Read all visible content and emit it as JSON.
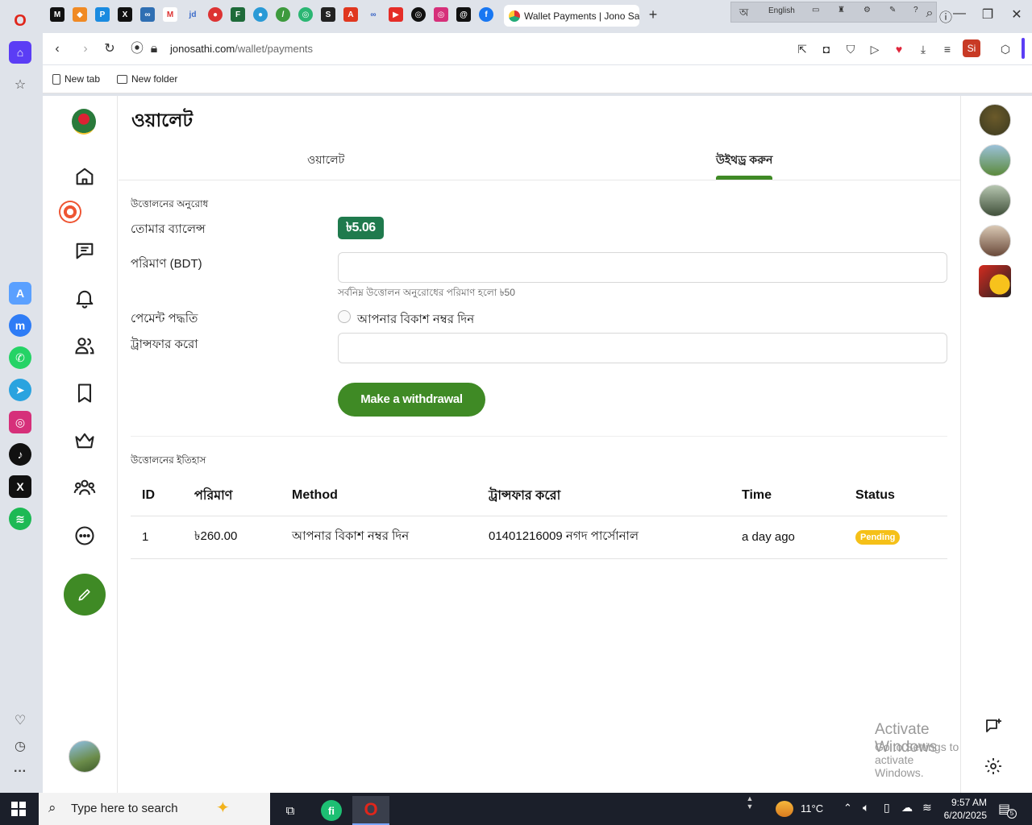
{
  "browser": {
    "active_tab_title": "Wallet Payments | Jono Sa",
    "new_tab_symbol": "+",
    "url_host": "jonosathi.com",
    "url_path": "/wallet/payments",
    "profile_initials": "Si",
    "tray_language": "English",
    "bookmarks": [
      "New tab",
      "New folder"
    ]
  },
  "page": {
    "title": "ওয়ালেট",
    "tabs": [
      {
        "label": "ওয়ালেট",
        "active": false
      },
      {
        "label": "উইথড্র করুন",
        "active": true
      }
    ],
    "withdraw_form": {
      "section_title": "উত্তোলনের অনুরোধ",
      "balance_label": "তোমার ব্যালেন্স",
      "balance_value": "৳5.06",
      "amount_label": "পরিমাণ (BDT)",
      "amount_value": "",
      "amount_hint": "সর্বনিম্ন উত্তোলন অনুরোধের পরিমাণ হলো ৳50",
      "payment_method_label": "পেমেন্ট পদ্ধতি",
      "payment_option_label": "আপনার বিকাশ নম্বর দিন",
      "transfer_label": "ট্রান্সফার করো",
      "transfer_value": "",
      "submit_label": "Make a withdrawal"
    },
    "history": {
      "section_title": "উত্তোলনের ইতিহাস",
      "columns": [
        "ID",
        "পরিমাণ",
        "Method",
        "ট্রান্সফার করো",
        "Time",
        "Status"
      ],
      "rows": [
        {
          "id": "1",
          "amount": "৳260.00",
          "method": "আপনার বিকাশ নম্বর দিন",
          "transfer": "01401216009 নগদ পার্সোনাল",
          "time": "a day ago",
          "status": "Pending"
        }
      ]
    },
    "watermark": {
      "line1": "Activate Windows",
      "line2": "Go to Settings to activate Windows."
    }
  },
  "taskbar": {
    "search_placeholder": "Type here to search",
    "temperature": "11°C",
    "time": "9:57 AM",
    "date": "6/20/2025",
    "notification_count": "5"
  },
  "colors": {
    "brand_green": "#3f8a25",
    "balance_badge": "#1f7a4d",
    "pending_badge": "#f5c018"
  }
}
